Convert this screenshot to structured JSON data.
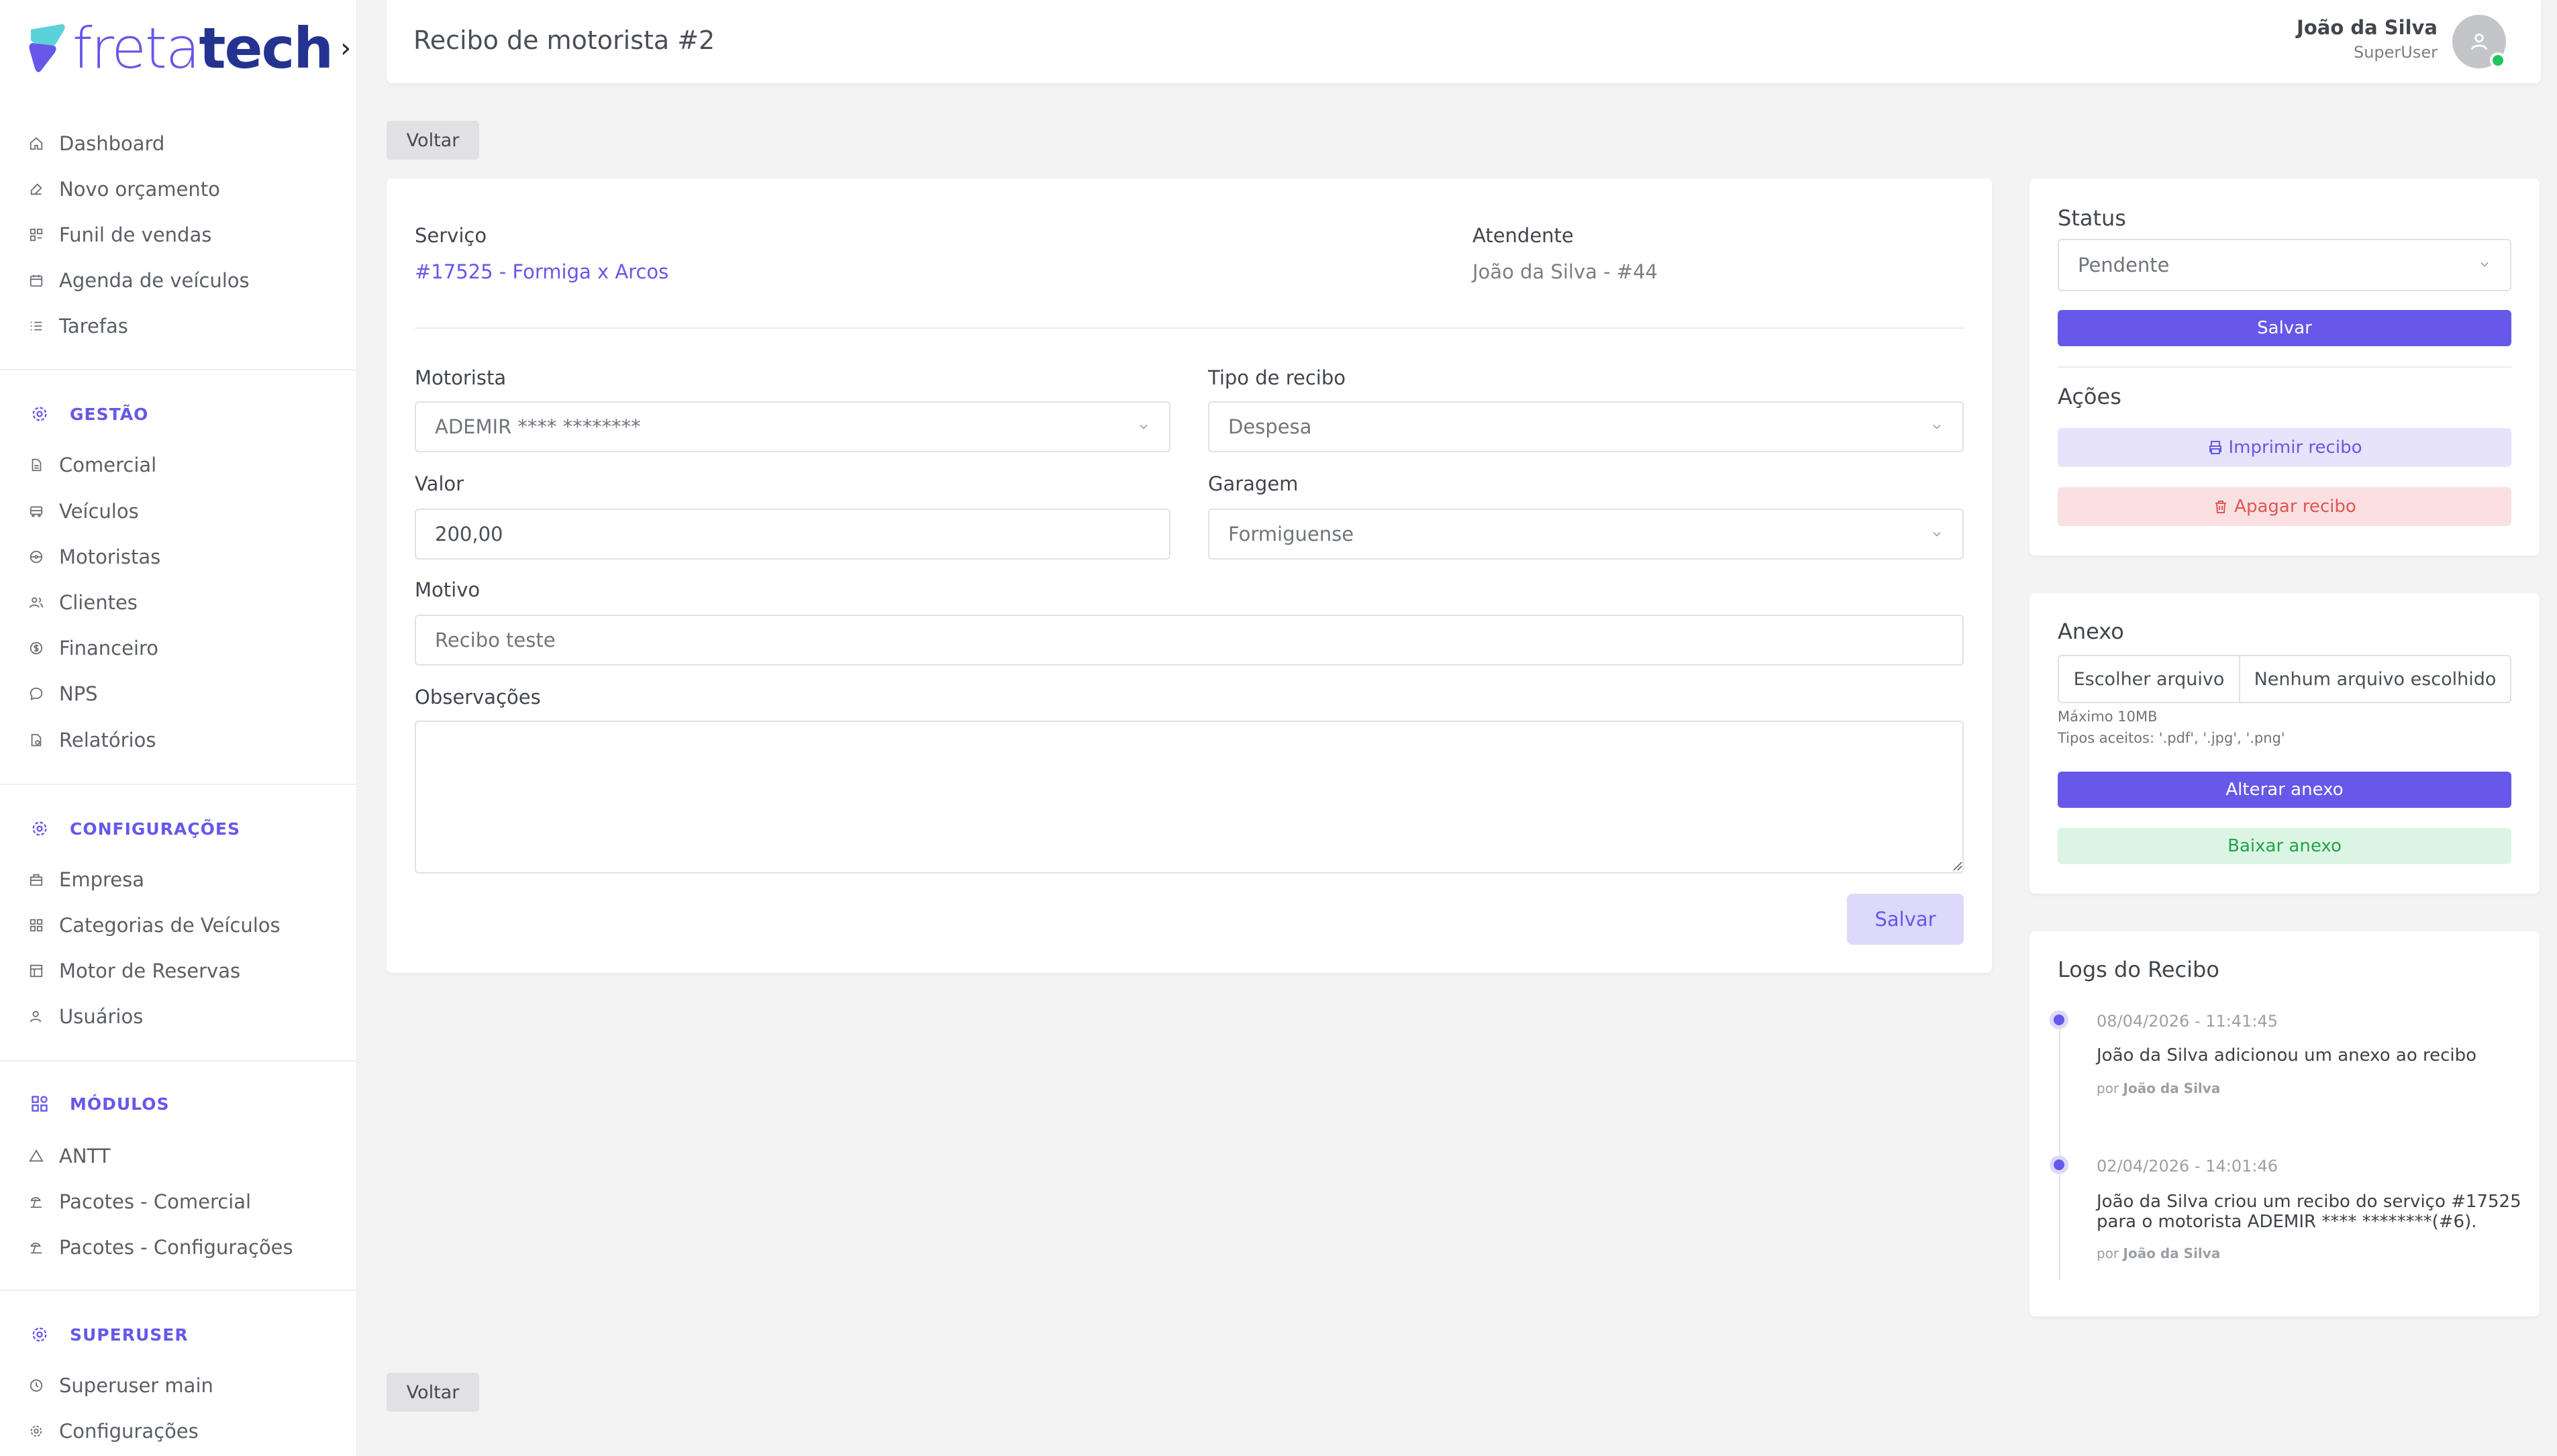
{
  "brand": {
    "logo_prefix": "freta",
    "logo_suffix": "tech"
  },
  "colors": {
    "accent": "#6658e8",
    "success": "#22c55e",
    "danger": "#e05555"
  },
  "sidebar": {
    "main_items": [
      {
        "label": "Dashboard",
        "icon": "home-icon"
      },
      {
        "label": "Novo orçamento",
        "icon": "edit-icon"
      },
      {
        "label": "Funil de vendas",
        "icon": "funnel-icon"
      },
      {
        "label": "Agenda de veículos",
        "icon": "calendar-icon"
      },
      {
        "label": "Tarefas",
        "icon": "list-icon"
      }
    ],
    "sections": [
      {
        "title": "GESTÃO",
        "items": [
          "Comercial",
          "Veículos",
          "Motoristas",
          "Clientes",
          "Financeiro",
          "NPS",
          "Relatórios"
        ]
      },
      {
        "title": "CONFIGURAÇÕES",
        "items": [
          "Empresa",
          "Categorias de Veículos",
          "Motor de Reservas",
          "Usuários"
        ]
      },
      {
        "title": "MÓDULOS",
        "items": [
          "ANTT",
          "Pacotes - Comercial",
          "Pacotes - Configurações"
        ]
      },
      {
        "title": "SUPERUSER",
        "items": [
          "Superuser main",
          "Configurações"
        ]
      }
    ]
  },
  "header": {
    "title": "Recibo de motorista #2",
    "user_name": "João da Silva",
    "user_role": "SuperUser"
  },
  "back_label": "Voltar",
  "form": {
    "service_label": "Serviço",
    "service_value": "#17525 - Formiga x Arcos",
    "attendant_label": "Atendente",
    "attendant_value": "João da Silva - #44",
    "driver_label": "Motorista",
    "driver_value": "ADEMIR **** ********",
    "type_label": "Tipo de recibo",
    "type_value": "Despesa",
    "amount_label": "Valor",
    "amount_value": "200,00",
    "garage_label": "Garagem",
    "garage_value": "Formiguense",
    "reason_label": "Motivo",
    "reason_value": "Recibo teste",
    "notes_label": "Observações",
    "notes_value": "",
    "save_label": "Salvar"
  },
  "status_panel": {
    "title": "Status",
    "value": "Pendente",
    "save_label": "Salvar",
    "actions_title": "Ações",
    "print_label": "Imprimir recibo",
    "delete_label": "Apagar recibo"
  },
  "attachment": {
    "title": "Anexo",
    "choose_label": "Escolher arquivo",
    "no_file_label": "Nenhum arquivo escolhido",
    "max_size": "Máximo 10MB",
    "types": "Tipos aceitos: '.pdf', '.jpg', '.png'",
    "change_label": "Alterar anexo",
    "download_label": "Baixar anexo"
  },
  "logs": {
    "title": "Logs do Recibo",
    "entries": [
      {
        "time": "08/04/2026 - 11:41:45",
        "text": "João da Silva adicionou um anexo ao recibo",
        "by_prefix": "por",
        "by_name": "João da Silva"
      },
      {
        "time": "02/04/2026 - 14:01:46",
        "text_line1": "João da Silva criou um recibo do serviço #17525",
        "text_line2": "para o motorista ADEMIR **** ********(#6).",
        "by_prefix": "por",
        "by_name": "João da Silva"
      }
    ]
  }
}
